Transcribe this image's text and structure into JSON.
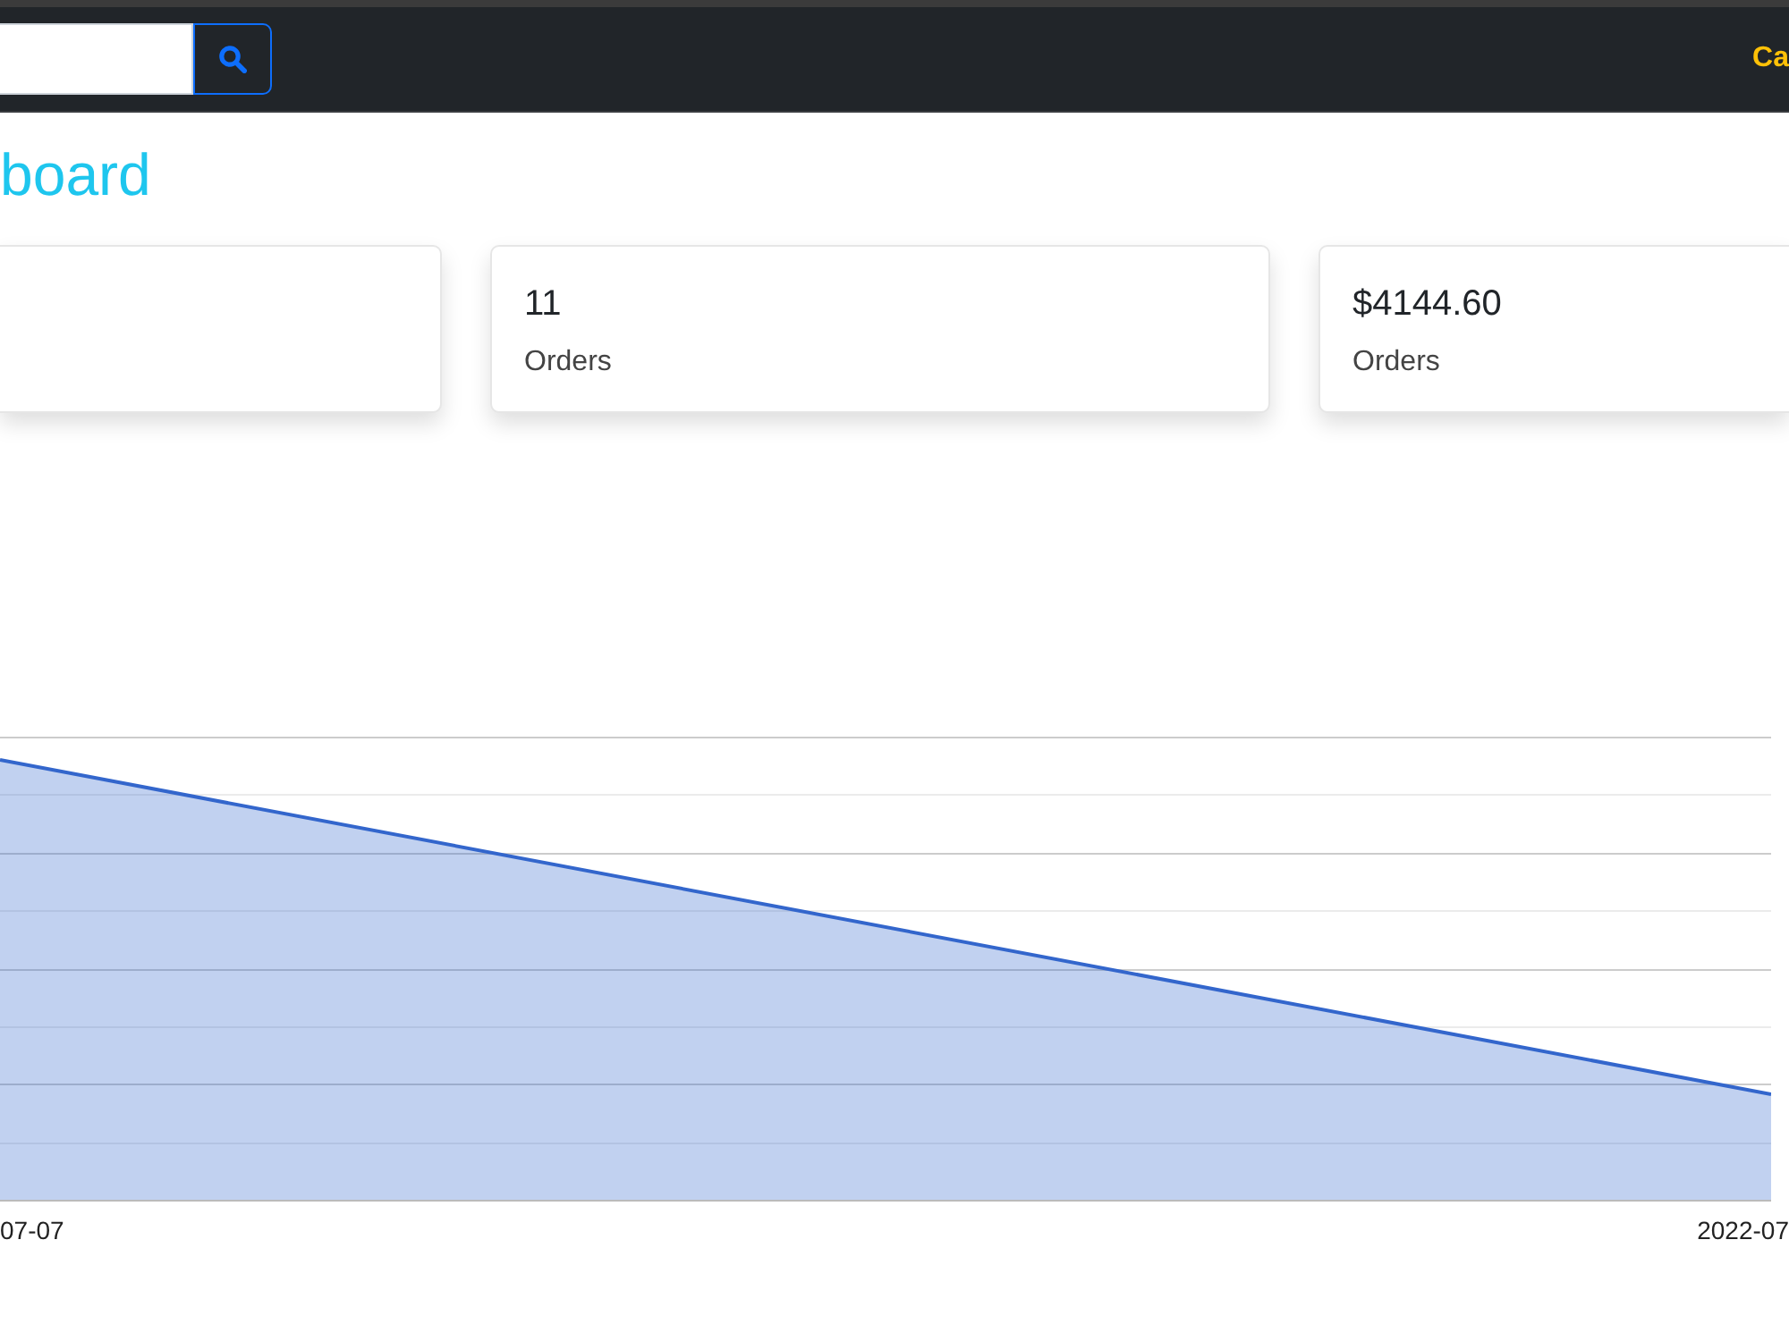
{
  "navbar": {
    "link": "Ca"
  },
  "title": "board",
  "cards": [
    {
      "kind": "blank"
    },
    {
      "kind": "stat",
      "value": "11",
      "label": "Orders"
    },
    {
      "kind": "stat",
      "value": "$4144.60",
      "label": "Orders"
    }
  ],
  "chart": {
    "x_labels": [
      "07-07",
      "2022-07"
    ]
  }
}
